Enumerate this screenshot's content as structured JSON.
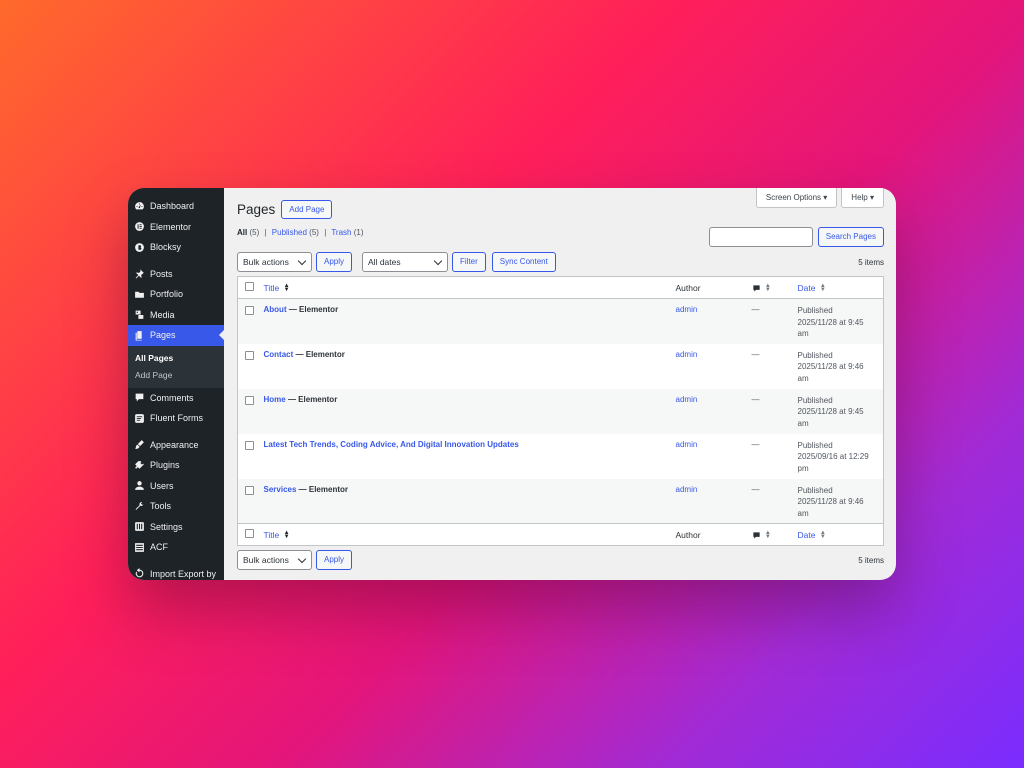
{
  "sidebar": {
    "items": [
      {
        "label": "Dashboard",
        "icon": "dashboard-icon"
      },
      {
        "label": "Elementor",
        "icon": "elementor-icon"
      },
      {
        "label": "Blocksy",
        "icon": "blocksy-icon"
      },
      {
        "label": "Posts",
        "icon": "pin-icon"
      },
      {
        "label": "Portfolio",
        "icon": "folder-icon"
      },
      {
        "label": "Media",
        "icon": "media-icon"
      },
      {
        "label": "Pages",
        "icon": "pages-icon"
      },
      {
        "label": "Comments",
        "icon": "comment-icon"
      },
      {
        "label": "Fluent Forms",
        "icon": "forms-icon"
      },
      {
        "label": "Appearance",
        "icon": "brush-icon"
      },
      {
        "label": "Plugins",
        "icon": "plug-icon"
      },
      {
        "label": "Users",
        "icon": "user-icon"
      },
      {
        "label": "Tools",
        "icon": "wrench-icon"
      },
      {
        "label": "Settings",
        "icon": "settings-icon"
      },
      {
        "label": "ACF",
        "icon": "acf-icon"
      },
      {
        "label": "Import Export by",
        "icon": "import-icon"
      }
    ],
    "submenu": [
      "All Pages",
      "Add Page"
    ]
  },
  "header": {
    "screen_options": "Screen Options ▾",
    "help": "Help ▾",
    "title": "Pages",
    "add_page": "Add Page"
  },
  "filters": {
    "all": "All",
    "all_count": "(5)",
    "published": "Published",
    "published_count": "(5)",
    "trash": "Trash",
    "trash_count": "(1)",
    "sep": "|"
  },
  "search": {
    "button": "Search Pages",
    "value": ""
  },
  "toolbar": {
    "bulk_actions": "Bulk actions",
    "apply": "Apply",
    "all_dates": "All dates",
    "filter": "Filter",
    "sync": "Sync Content",
    "items_count": "5 items"
  },
  "table": {
    "headers": {
      "title": "Title",
      "author": "Author",
      "date": "Date"
    },
    "rows": [
      {
        "title": "About",
        "state": " — Elementor",
        "author": "admin",
        "comments": "—",
        "status": "Published",
        "date": "2025/11/28 at 9:45",
        "time_suffix": "am"
      },
      {
        "title": "Contact",
        "state": " — Elementor",
        "author": "admin",
        "comments": "—",
        "status": "Published",
        "date": "2025/11/28 at 9:46",
        "time_suffix": "am"
      },
      {
        "title": "Home",
        "state": " — Elementor",
        "author": "admin",
        "comments": "—",
        "status": "Published",
        "date": "2025/11/28 at 9:45",
        "time_suffix": "am"
      },
      {
        "title": "Latest Tech Trends, Coding Advice, And Digital Innovation Updates",
        "state": "",
        "author": "admin",
        "comments": "—",
        "status": "Published",
        "date": "2025/09/16 at 12:29",
        "time_suffix": "pm"
      },
      {
        "title": "Services",
        "state": " — Elementor",
        "author": "admin",
        "comments": "—",
        "status": "Published",
        "date": "2025/11/28 at 9:46",
        "time_suffix": "am"
      }
    ]
  },
  "colors": {
    "accent": "#3858e9",
    "sidebar_bg": "#1d2327"
  }
}
